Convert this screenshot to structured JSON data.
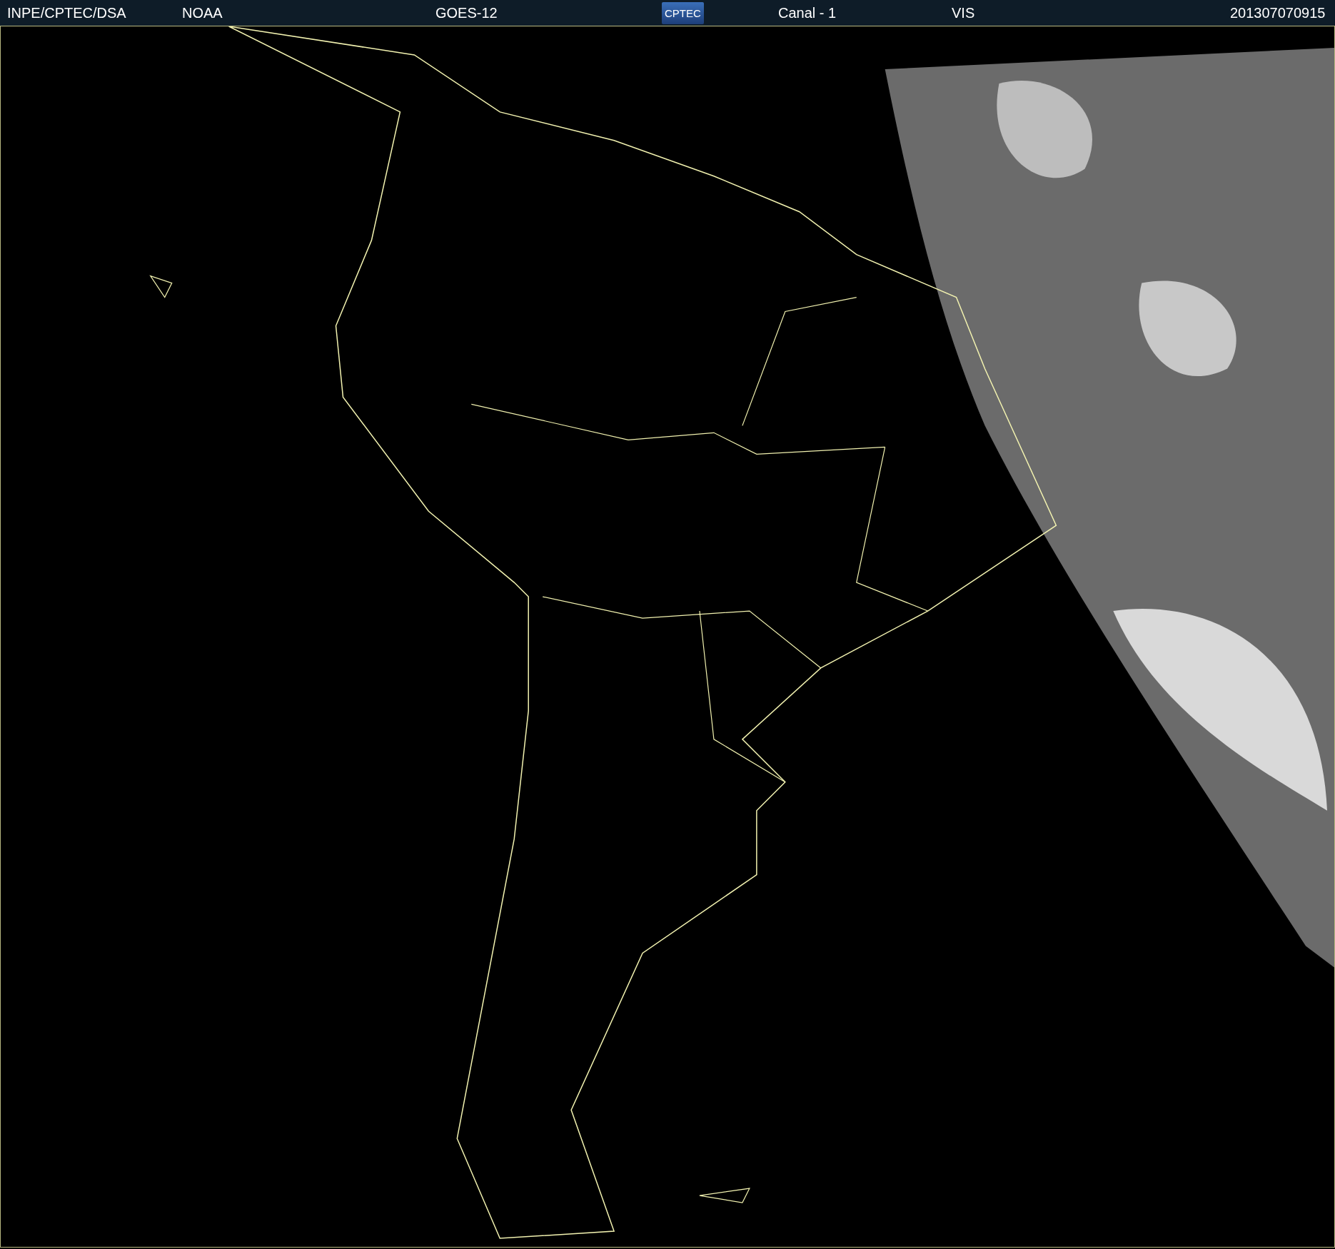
{
  "header": {
    "source": "INPE/CPTEC/DSA",
    "agency": "NOAA",
    "satellite": "GOES-12",
    "logo": "CPTEC",
    "channel": "Canal - 1",
    "band": "VIS",
    "timestamp": "201307070915"
  }
}
